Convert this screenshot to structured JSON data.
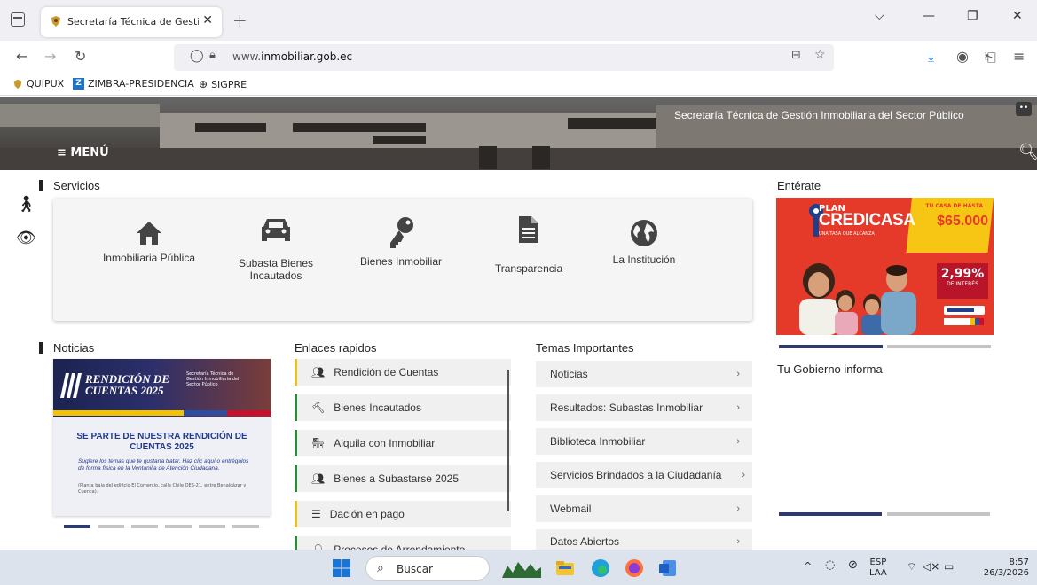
{
  "browser": {
    "tab_title": "Secretaría Técnica de Gestión In",
    "tab_close": "✕",
    "new_tab": "+",
    "url_prefix": "www.",
    "url_domain": "inmobiliar.gob.ec",
    "bookmarks": [
      "QUIPUX",
      "ZIMBRA-PRESIDENCIA",
      "SIGPRE"
    ]
  },
  "header": {
    "site_title": "Secretaría Técnica de Gestión Inmobiliaria del Sector Público",
    "menu_label": "≡ MENÚ"
  },
  "sections": {
    "services": "Servicios",
    "enterate": "Entérate",
    "news": "Noticias",
    "links": "Enlaces rapidos",
    "topics": "Temas Importantes",
    "gov": "Tu Gobierno informa"
  },
  "services": [
    {
      "label": "Inmobiliaria Pública",
      "icon": "home-icon"
    },
    {
      "label": "Subasta Bienes Incautados",
      "icon": "car-icon"
    },
    {
      "label": "Bienes Inmobiliar",
      "icon": "key-icon"
    },
    {
      "label": "Transparencia",
      "icon": "document-icon"
    },
    {
      "label": "La Institución",
      "icon": "globe-icon"
    }
  ],
  "banner": {
    "plan": "PLAN",
    "name": "CREDICASA",
    "tagline": "UNA TASA QUE ALCANZA",
    "amount_caption": "TU CASA DE HASTA",
    "amount": "$65.000",
    "rate": "2,99%",
    "rate_caption": "DE INTERÉS"
  },
  "news": {
    "banner_title_1": "RENDICIÓN DE",
    "banner_title_2": "CUENTAS 2025",
    "banner_small": "Secretaría Técnica de Gestión Inmobiliaria del Sector Público",
    "headline": "SE PARTE DE NUESTRA RENDICIÓN DE CUENTAS 2025",
    "body": "Sugiere los temas que te gustaría tratar. Haz clic aquí o entrégalos de forma física en la Ventanilla de Atención Ciudadana.",
    "address": "(Planta baja del edificio El Comercio, calle Chile OE6-21, entre Benalcázar y Cuenca)."
  },
  "links": [
    {
      "label": "Rendición de Cuentas",
      "icon": "people-icon"
    },
    {
      "label": "Bienes Incautados",
      "icon": "gavel-icon"
    },
    {
      "label": "Alquila con Inmobiliar",
      "icon": "store-icon"
    },
    {
      "label": "Bienes a Subastarse 2025",
      "icon": "group-icon"
    },
    {
      "label": "Dación en pago",
      "icon": "list-icon"
    },
    {
      "label": "Procesos de Arrendamiento",
      "icon": "person-icon"
    }
  ],
  "topics": [
    "Noticias",
    "Resultados: Subastas Inmobiliar",
    "Biblioteca Inmobiliar",
    "Servicios Brindados a la Ciudadanía",
    "Webmail",
    "Datos Abiertos"
  ],
  "taskbar": {
    "search": "Buscar",
    "lang_1": "ESP",
    "lang_2": "LAA",
    "time": "8:57",
    "date": "26/3/2026"
  },
  "colors": {
    "accent_yellow": "#e0c42a",
    "accent_green": "#2e8b3e",
    "banner_red": "#e53a2a",
    "carousel_active": "#2c3a6e"
  }
}
